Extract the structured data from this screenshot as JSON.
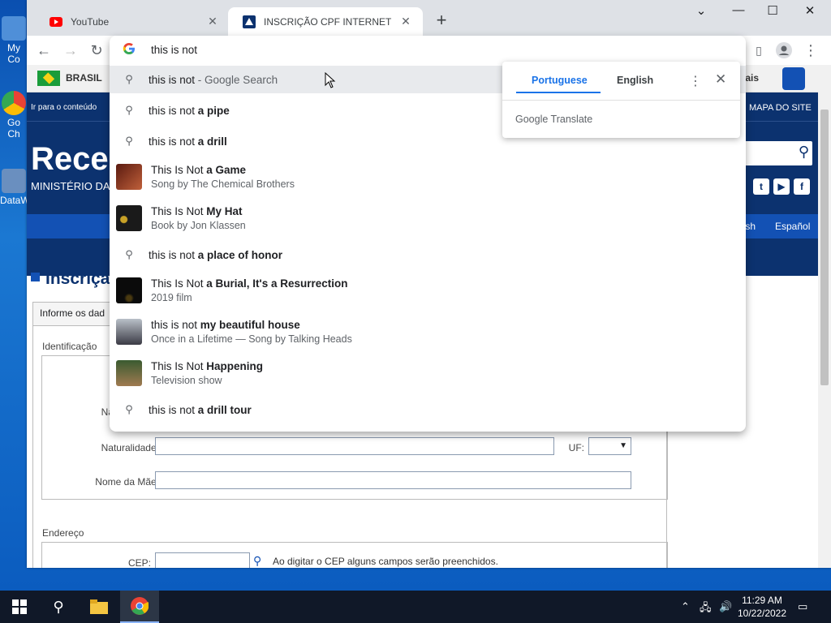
{
  "desktop": {
    "icons": [
      {
        "label": "My Co"
      },
      {
        "label": "Go Ch"
      },
      {
        "label": "DataW"
      }
    ]
  },
  "browser": {
    "tabs": [
      {
        "title": "YouTube",
        "active": false
      },
      {
        "title": "INSCRIÇÃO CPF INTERNET",
        "active": true
      }
    ],
    "new_tab": "+",
    "window_controls": {
      "minimize": "—",
      "maximize": "☐",
      "close": "✕",
      "tab_search": "⌄"
    }
  },
  "omnibox": {
    "query": "this is not",
    "suggestions": [
      {
        "icon": "search-icon",
        "plain": "this is not",
        "bold": "",
        "suffix": " - Google Search",
        "sub": "",
        "highlighted": true
      },
      {
        "icon": "search-icon",
        "plain": "this is not ",
        "bold": "a pipe",
        "suffix": "",
        "sub": ""
      },
      {
        "icon": "search-icon",
        "plain": "this is not ",
        "bold": "a drill",
        "suffix": "",
        "sub": ""
      },
      {
        "icon": "thumbnail",
        "plain": "This Is Not ",
        "bold": "a Game",
        "suffix": "",
        "sub": "Song by The Chemical Brothers"
      },
      {
        "icon": "thumbnail",
        "plain": "This Is Not ",
        "bold": "My Hat",
        "suffix": "",
        "sub": "Book by Jon Klassen"
      },
      {
        "icon": "search-icon",
        "plain": "this is not ",
        "bold": "a place of honor",
        "suffix": "",
        "sub": ""
      },
      {
        "icon": "thumbnail",
        "plain": "This Is Not ",
        "bold": "a Burial, It's a Resurrection",
        "suffix": "",
        "sub": "2019 film"
      },
      {
        "icon": "thumbnail",
        "plain": "this is not ",
        "bold": "my beautiful house",
        "suffix": "",
        "sub": "Once in a Lifetime — Song by Talking Heads"
      },
      {
        "icon": "thumbnail",
        "plain": "This Is Not ",
        "bold": "Happening",
        "suffix": "",
        "sub": "Television show"
      },
      {
        "icon": "search-icon",
        "plain": "this is not ",
        "bold": "a drill tour",
        "suffix": "",
        "sub": ""
      }
    ]
  },
  "translate": {
    "source_lang": "Portuguese",
    "target_lang": "English",
    "brand": "Google Translate"
  },
  "page": {
    "gov_bar": {
      "country": "BRASIL",
      "right_text": "nais"
    },
    "skip_link": "Ir para o conteúdo",
    "site_map": "MAPA DO SITE",
    "site_title": "Recei",
    "ministry": "MINISTÉRIO DA",
    "languages": [
      "lish",
      "Español"
    ],
    "content_title": "Inscriçã",
    "form_header": "Informe os dad",
    "sections": {
      "identification": "Identificação",
      "address": "Endereço"
    },
    "fields": {
      "nascimento_label": "Nas",
      "naturalidade_label": "Naturalidade:",
      "uf_label": "UF:",
      "mae_label": "Nome da Mãe:",
      "cep_label": "CEP:",
      "cep_hint": "Ao digitar o CEP alguns campos serão preenchidos."
    }
  },
  "taskbar": {
    "time": "11:29 AM",
    "date": "10/22/2022"
  },
  "colors": {
    "gov_blue": "#0c326f",
    "gov_accent": "#1351b4",
    "chrome_tabstrip": "#dee1e6",
    "link_blue": "#1a73e8"
  }
}
